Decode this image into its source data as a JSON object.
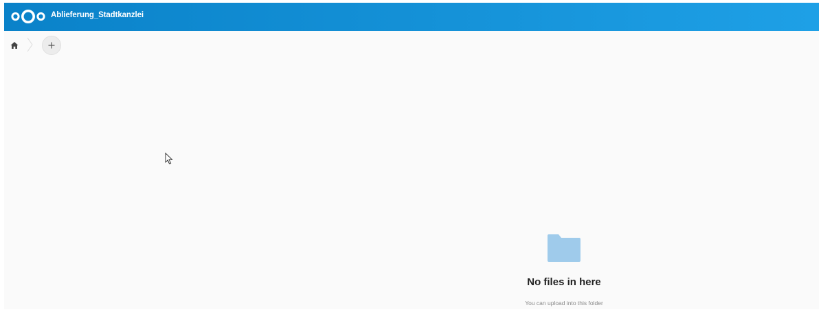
{
  "header": {
    "app_title": "Ablieferung_Stadtkanzlei",
    "logo_icon": "nextcloud-logo-icon"
  },
  "breadcrumb": {
    "home_icon": "home-icon",
    "separator_icon": "chevron-right-icon",
    "new_button_icon": "plus-icon"
  },
  "empty_state": {
    "icon": "folder-icon",
    "title": "No files in here",
    "subtitle": "You can upload into this folder"
  },
  "colors": {
    "header_start": "#0a82c9",
    "header_end": "#1ea0e6",
    "folder": "#9fcbeb",
    "background": "#fafafa"
  }
}
